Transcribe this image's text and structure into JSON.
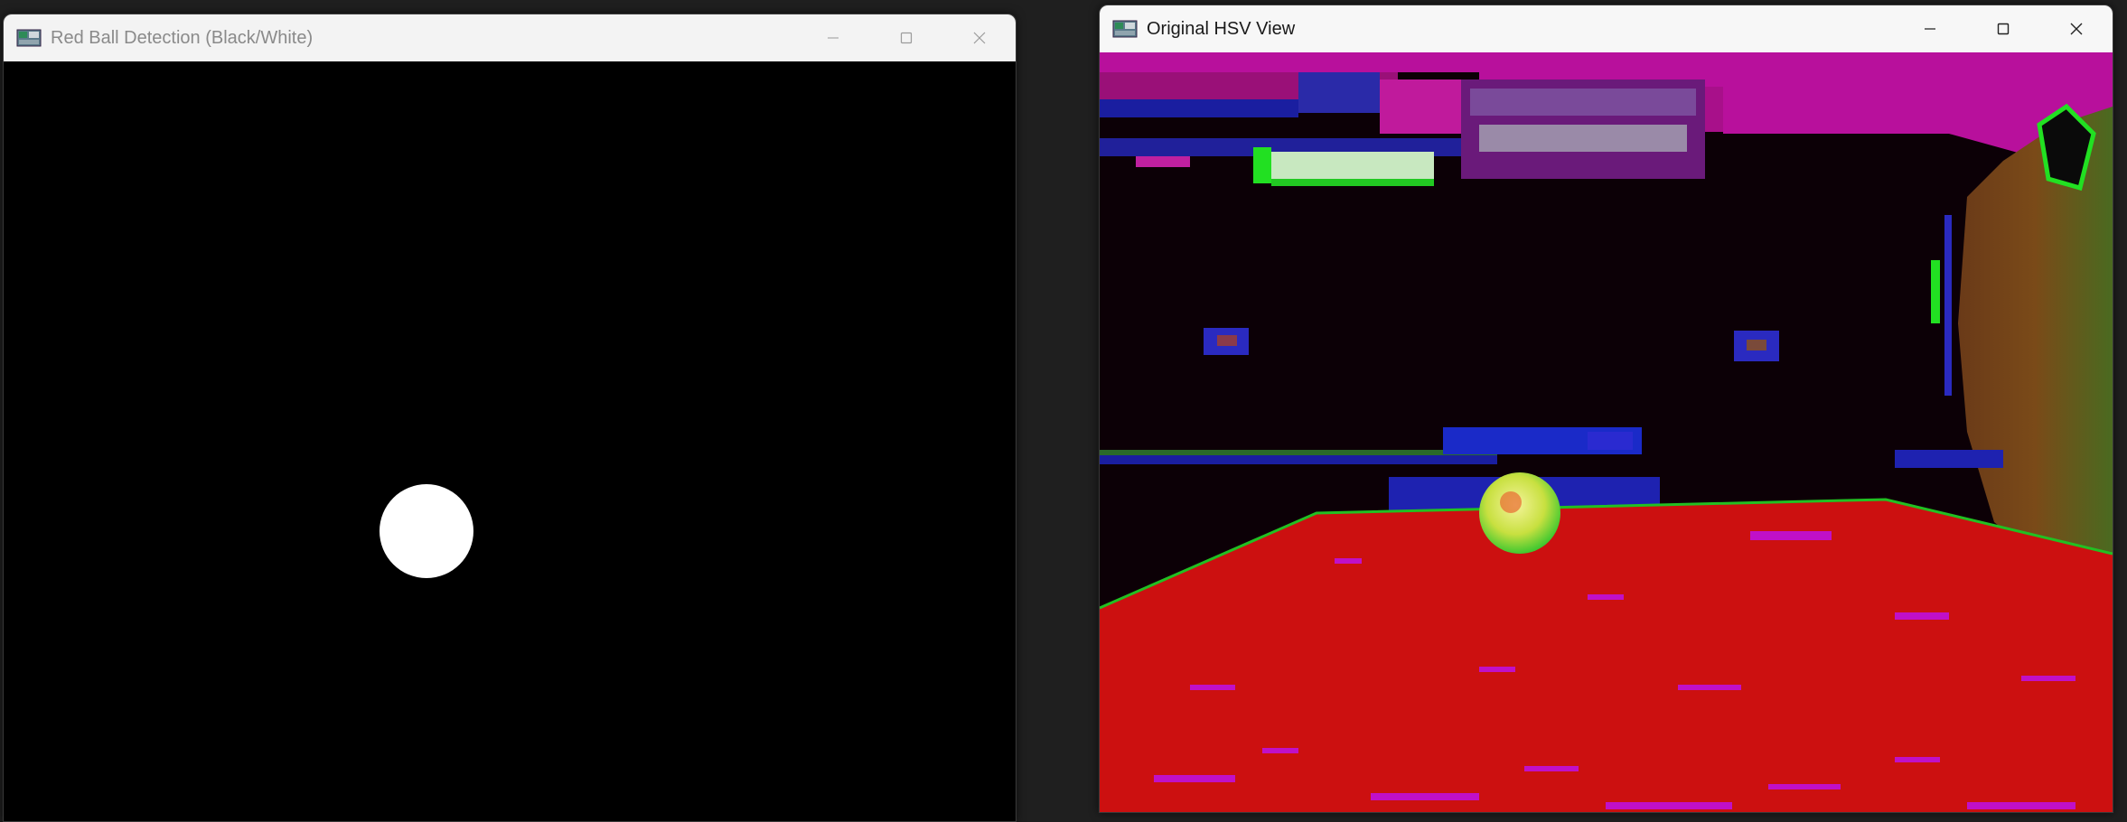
{
  "windows": {
    "left": {
      "title": "Red Ball Detection (Black/White)",
      "icon": "opencv-window-icon",
      "controls": [
        "minimize-icon",
        "maximize-icon",
        "close-icon"
      ],
      "content": {
        "description_kind": "binary-mask",
        "background": "#000000",
        "blob_color": "#ffffff"
      }
    },
    "right": {
      "title": "Original HSV View",
      "icon": "opencv-window-icon",
      "controls": [
        "minimize-icon",
        "maximize-icon",
        "close-icon"
      ],
      "content": {
        "description_kind": "hsv-camera-frame",
        "floor_color": "#cc1010",
        "accent_magenta": "#c010c8",
        "accent_green": "#22e022",
        "accent_blue": "#1a22c8"
      }
    }
  },
  "colors": {
    "desktop": "#1f1f1f",
    "titlebar": "#f3f3f3",
    "inactive_title": "#8a8a8a",
    "active_title": "#1a1a1a"
  }
}
